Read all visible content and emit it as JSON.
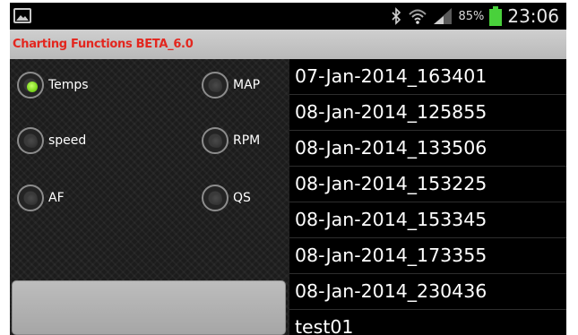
{
  "status_bar": {
    "battery_percent": "85%",
    "time": "23:06",
    "icons": [
      "gallery-icon",
      "bluetooth-icon",
      "wifi-icon",
      "signal-icon",
      "battery-icon"
    ],
    "battery_color": "#49d13b"
  },
  "title_bar": {
    "title": "Charting Functions BETA_6.0",
    "title_color": "#e3261e"
  },
  "options": [
    {
      "label": "Temps",
      "selected": true
    },
    {
      "label": "MAP",
      "selected": false
    },
    {
      "label": "speed",
      "selected": false
    },
    {
      "label": "RPM",
      "selected": false
    },
    {
      "label": "AF",
      "selected": false
    },
    {
      "label": "QS",
      "selected": false
    }
  ],
  "action_button": {
    "label": ""
  },
  "files": [
    "07-Jan-2014_163401",
    "08-Jan-2014_125855",
    "08-Jan-2014_133506",
    "08-Jan-2014_153225",
    "08-Jan-2014_153345",
    "08-Jan-2014_173355",
    "08-Jan-2014_230436",
    "test01"
  ],
  "colors": {
    "radio_selected": "#7ed81f",
    "list_background": "#000000"
  }
}
